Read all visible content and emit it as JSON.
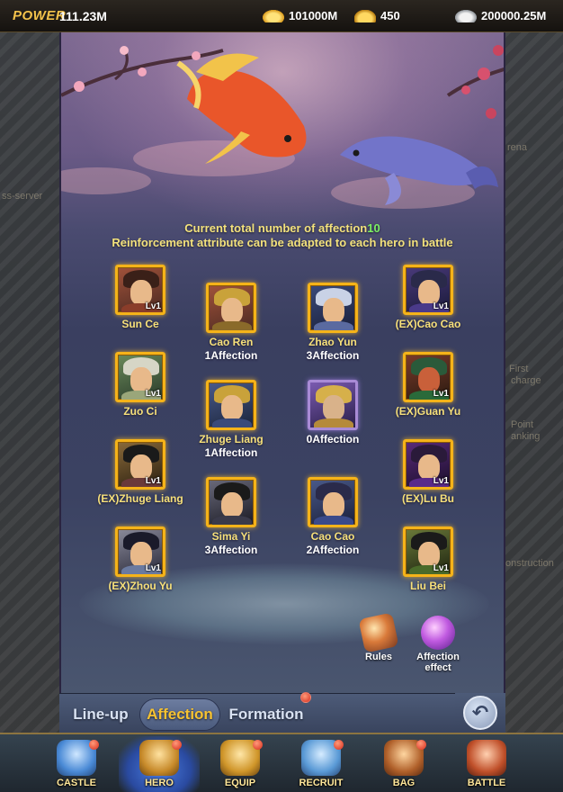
{
  "topbar": {
    "power_label": "POWER",
    "power_value": "111.23M",
    "gold": "101000M",
    "ingot": "450",
    "silver": "200000.25M",
    "icons": [
      "gold-coins-icon",
      "gold-ingot-icon",
      "silver-coins-icon"
    ]
  },
  "info": {
    "line1_prefix": "Current total number of affection",
    "line1_count": "10",
    "line2": "Reinforcement attribute can be adapted to each hero in battle"
  },
  "heroes": [
    {
      "name": "Sun Ce",
      "level": "Lv1",
      "affection": ""
    },
    {
      "name": "Cao Ren",
      "level": "",
      "affection": "1Affection"
    },
    {
      "name": "Zhao Yun",
      "level": "",
      "affection": "3Affection"
    },
    {
      "name": "(EX)Cao Cao",
      "level": "Lv1",
      "affection": ""
    },
    {
      "name": "Zuo Ci",
      "level": "Lv1",
      "affection": ""
    },
    {
      "name": "Zhuge Liang",
      "level": "",
      "affection": "1Affection"
    },
    {
      "name": "",
      "level": "",
      "affection": "0Affection"
    },
    {
      "name": "(EX)Guan Yu",
      "level": "Lv1",
      "affection": ""
    },
    {
      "name": "(EX)Zhuge Liang",
      "level": "Lv1",
      "affection": ""
    },
    {
      "name": "Sima Yi",
      "level": "",
      "affection": "3Affection"
    },
    {
      "name": "Cao Cao",
      "level": "",
      "affection": "2Affection"
    },
    {
      "name": "(EX)Lu Bu",
      "level": "Lv1",
      "affection": ""
    },
    {
      "name": "(EX)Zhou Yu",
      "level": "Lv1",
      "affection": ""
    },
    {
      "name": "Liu Bei",
      "level": "Lv1",
      "affection": ""
    }
  ],
  "actions": {
    "rules_label": "Rules",
    "affection_effect_label": "Affection effect"
  },
  "tabs": {
    "lineup": "Line-up",
    "affection": "Affection",
    "formation": "Formation"
  },
  "nav": {
    "castle": "CASTLE",
    "hero": "HERO",
    "equip": "EQUIP",
    "recruit": "RECRUIT",
    "bag": "BAG",
    "battle": "BATTLE"
  },
  "background_labels": {
    "left_server": "ss-server",
    "right_arena": "rena",
    "right_first": "First",
    "right_recharge": "charge",
    "right_point": "Point",
    "right_ranking": "anking",
    "right_construction": "onstruction"
  },
  "colors": {
    "accent_gold": "#f6c231",
    "name_yellow": "#f6e07a",
    "count_green": "#7cf062",
    "locked_purple": "#b77af5"
  }
}
